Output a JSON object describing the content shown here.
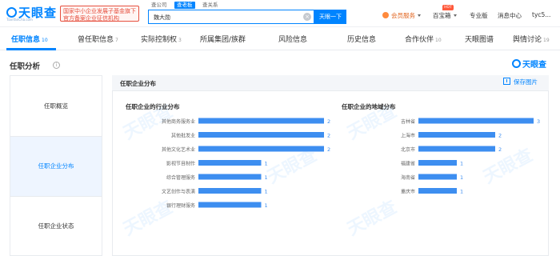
{
  "header": {
    "logo_text": "天眼查",
    "logo_sub": "TianYanCha.com",
    "gov_badge": [
      "国家中小企业发展子基金旗下",
      "官方备案企业征信机构"
    ],
    "search_tabs": [
      "查公司",
      "查老板",
      "查关系"
    ],
    "search_value": "魏大勋",
    "search_clear_icon": "clear-circle-icon",
    "search_button": "天眼一下",
    "nav": {
      "vip": "会员服务",
      "baobao": "百宝箱",
      "hot": "HOT",
      "pro": "专业版",
      "messages": "消息中心",
      "user": "tyc5..."
    }
  },
  "tabs": [
    {
      "label": "任职信息",
      "count": "10"
    },
    {
      "label": "曾任职信息",
      "count": "7"
    },
    {
      "label": "实际控制权",
      "count": "3"
    },
    {
      "label": "所属集团/族群",
      "count": ""
    },
    {
      "label": "风险信息",
      "count": ""
    },
    {
      "label": "历史信息",
      "count": ""
    },
    {
      "label": "合作伙伴",
      "count": "10"
    },
    {
      "label": "天眼图谱",
      "count": ""
    },
    {
      "label": "舆情讨论",
      "count": "19"
    }
  ],
  "section": {
    "title": "任职分析",
    "info_icon": "info-circle-icon",
    "brand": "天眼查"
  },
  "left_nav": [
    "任职概览",
    "任职企业分布",
    "任职企业状态"
  ],
  "panel": {
    "title": "任职企业分布",
    "save_label": "保存图片",
    "save_icon": "download-icon",
    "watermark": "天眼查"
  },
  "chart_data": [
    {
      "type": "bar",
      "title": "任职企业的行业分布",
      "categories": [
        "其他商务服务业",
        "其他批发业",
        "其他文化艺术业",
        "影视节目制作",
        "综合管理服务",
        "文艺创作与表演",
        "银行理财服务"
      ],
      "values": [
        2,
        2,
        2,
        1,
        1,
        1,
        1
      ],
      "color": "#3d8ef0"
    },
    {
      "type": "bar",
      "title": "任职企业的地域分布",
      "categories": [
        "吉林省",
        "上海市",
        "北京市",
        "福建省",
        "海南省",
        "重庆市"
      ],
      "values": [
        3,
        2,
        2,
        1,
        1,
        1
      ],
      "color": "#3d8ef0"
    }
  ]
}
